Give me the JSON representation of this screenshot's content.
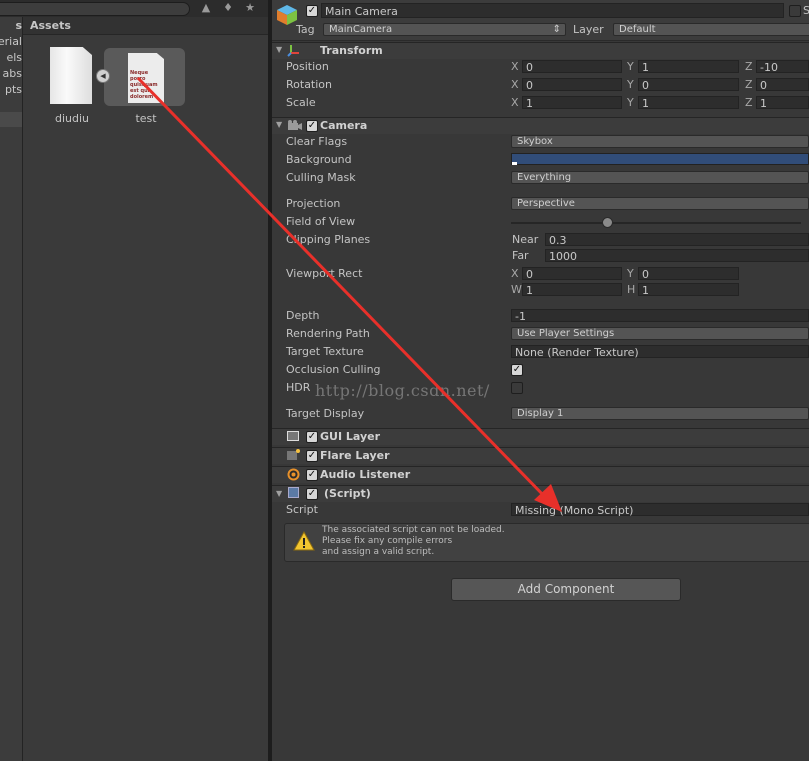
{
  "project": {
    "tree_items": [
      "Materials",
      "Models",
      "Prefabs",
      "Scripts"
    ],
    "tree_partial": [
      "s",
      "erial",
      "els",
      "abs",
      "pts"
    ],
    "assets_title": "Assets",
    "assets": [
      {
        "name": "diudiu",
        "type": "text-file-icon"
      },
      {
        "name": "test",
        "type": "script-file-icon",
        "preview_text": "Neque porro quisquam est qui dolorem"
      }
    ]
  },
  "inspector": {
    "object_name": "Main Camera",
    "static_label": "S",
    "tag_label": "Tag",
    "tag_value": "MainCamera",
    "layer_label": "Layer",
    "layer_value": "Default",
    "transform": {
      "title": "Transform",
      "rows": [
        {
          "label": "Position",
          "x": "0",
          "y": "1",
          "z": "-10"
        },
        {
          "label": "Rotation",
          "x": "0",
          "y": "0",
          "z": "0"
        },
        {
          "label": "Scale",
          "x": "1",
          "y": "1",
          "z": "1"
        }
      ]
    },
    "camera": {
      "title": "Camera",
      "clear_flags": {
        "label": "Clear Flags",
        "value": "Skybox"
      },
      "background": {
        "label": "Background",
        "color": "#314d79"
      },
      "culling_mask": {
        "label": "Culling Mask",
        "value": "Everything"
      },
      "projection": {
        "label": "Projection",
        "value": "Perspective"
      },
      "fov": {
        "label": "Field of View"
      },
      "clipping": {
        "label": "Clipping Planes",
        "near_label": "Near",
        "near": "0.3",
        "far_label": "Far",
        "far": "1000"
      },
      "viewport": {
        "label": "Viewport Rect",
        "x": "0",
        "y": "0",
        "w": "1",
        "h": "1"
      },
      "depth": {
        "label": "Depth",
        "value": "-1"
      },
      "rendering_path": {
        "label": "Rendering Path",
        "value": "Use Player Settings"
      },
      "target_texture": {
        "label": "Target Texture",
        "value": "None (Render Texture)"
      },
      "occlusion": {
        "label": "Occlusion Culling",
        "checked": true
      },
      "hdr": {
        "label": "HDR",
        "checked": false
      },
      "target_display": {
        "label": "Target Display",
        "value": "Display 1"
      }
    },
    "components": [
      {
        "title": "GUI Layer"
      },
      {
        "title": "Flare Layer"
      },
      {
        "title": "Audio Listener"
      },
      {
        "title": "(Script)"
      }
    ],
    "script": {
      "label": "Script",
      "value": "Missing (Mono Script)",
      "warning": "The associated script can not be loaded.\nPlease fix any compile errors\nand assign a valid script."
    },
    "add_component": "Add Component"
  },
  "watermark": "http://blog.csdn.net/",
  "arrow_color": "#e8302a"
}
